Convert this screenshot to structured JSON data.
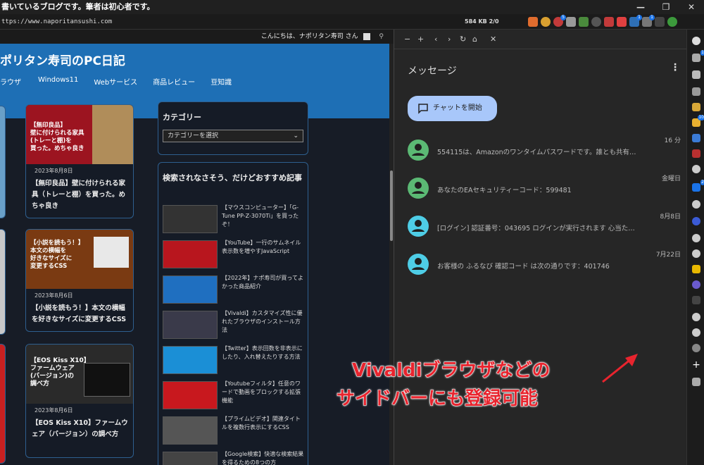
{
  "window": {
    "title": "書いているブログです。筆者は初心者です。",
    "controls": [
      "—",
      "❐",
      "✕"
    ]
  },
  "address": {
    "url": "ttps://www.naporitansushi.com",
    "stats": "584 KB  2/0"
  },
  "ext_badges": [
    "5",
    "1",
    "1"
  ],
  "page": {
    "greeting": "こんにちは、ナポリタン寿司 さん",
    "site_title": "ポリタン寿司のPC日記",
    "nav": [
      "ラウザ",
      "Windows11",
      "Webサービス",
      "商品レビュー",
      "豆知識"
    ],
    "cards": [
      {
        "thumb_text": "【無印良品】\n壁に付けられる家具\n(トレーと棚)を\n買った。めちゃ良き",
        "date": "2023年8月8日",
        "title": "【無印良品】壁に付けられる家具（トレーと棚）を買った。めちゃ良き"
      },
      {
        "thumb_text": "【小説を読もう！】\n本文の横幅を\n好きなサイズに\n変更するCSS",
        "date": "2023年8月6日",
        "title": "【小説を読もう！】本文の横幅を好きなサイズに変更するCSS"
      },
      {
        "thumb_text": "【EOS Kiss X10】\nファームウェア\n(バージョン)の\n調べ方",
        "date": "2023年8月6日",
        "title": "【EOS Kiss X10】ファームウェア（バージョン）の調べ方"
      }
    ],
    "category_widget": {
      "title": "カテゴリー",
      "select": "カテゴリーを選択"
    },
    "recommend_widget": {
      "title": "検索されなさそう、だけどおすすめ記事",
      "items": [
        "【マウスコンピューター】「G-Tune PP-Z-3070Ti」を買ったぞ！",
        "【YouTube】一行のサムネイル表示数を増やすJavaScript",
        "【2022年】ナポ寿司が買ってよかった商品紹介",
        "【Vivaldi】カスタマイズ性に優れたブラウザのインストール方法",
        "【Twitter】表示回数を非表示にしたり、入れ替えたりする方法",
        "【Youtubeフィルタ】任意のワードで動画をブロックする拡張機能",
        "【プライムビデオ】関連タイトルを複数行表示にするCSS",
        "【Google検索】快適な検索結果を得るための8つの方"
      ]
    }
  },
  "panel": {
    "toolbar": [
      "−",
      "+",
      "‹",
      "›",
      "↻",
      "⌂",
      "✕"
    ],
    "title": "メッセージ",
    "menu": "⋮",
    "chat_button": "チャットを開始",
    "messages": [
      {
        "time": "16 分",
        "text": "554115は、Amazonのワンタイムパスワードです。誰とも共有…",
        "color": "#5bb974"
      },
      {
        "time": "金曜日",
        "text": "あなたのEAセキュリティーコード：599481",
        "color": "#5bb974"
      },
      {
        "time": "8月8日",
        "text": "[ログイン] 認証番号：043695 ログインが実行されます 心当た…",
        "color": "#4ecde6"
      },
      {
        "time": "7月22日",
        "text": "お客様の ふるなび 確認コード は次の通りです：401746",
        "color": "#4ecde6"
      }
    ]
  },
  "sidebar_badges": [
    "1",
    "10",
    "2"
  ],
  "overlay": {
    "line1": "Vivaldiブラウザなどの",
    "line2": "サイドバーにも登録可能"
  }
}
